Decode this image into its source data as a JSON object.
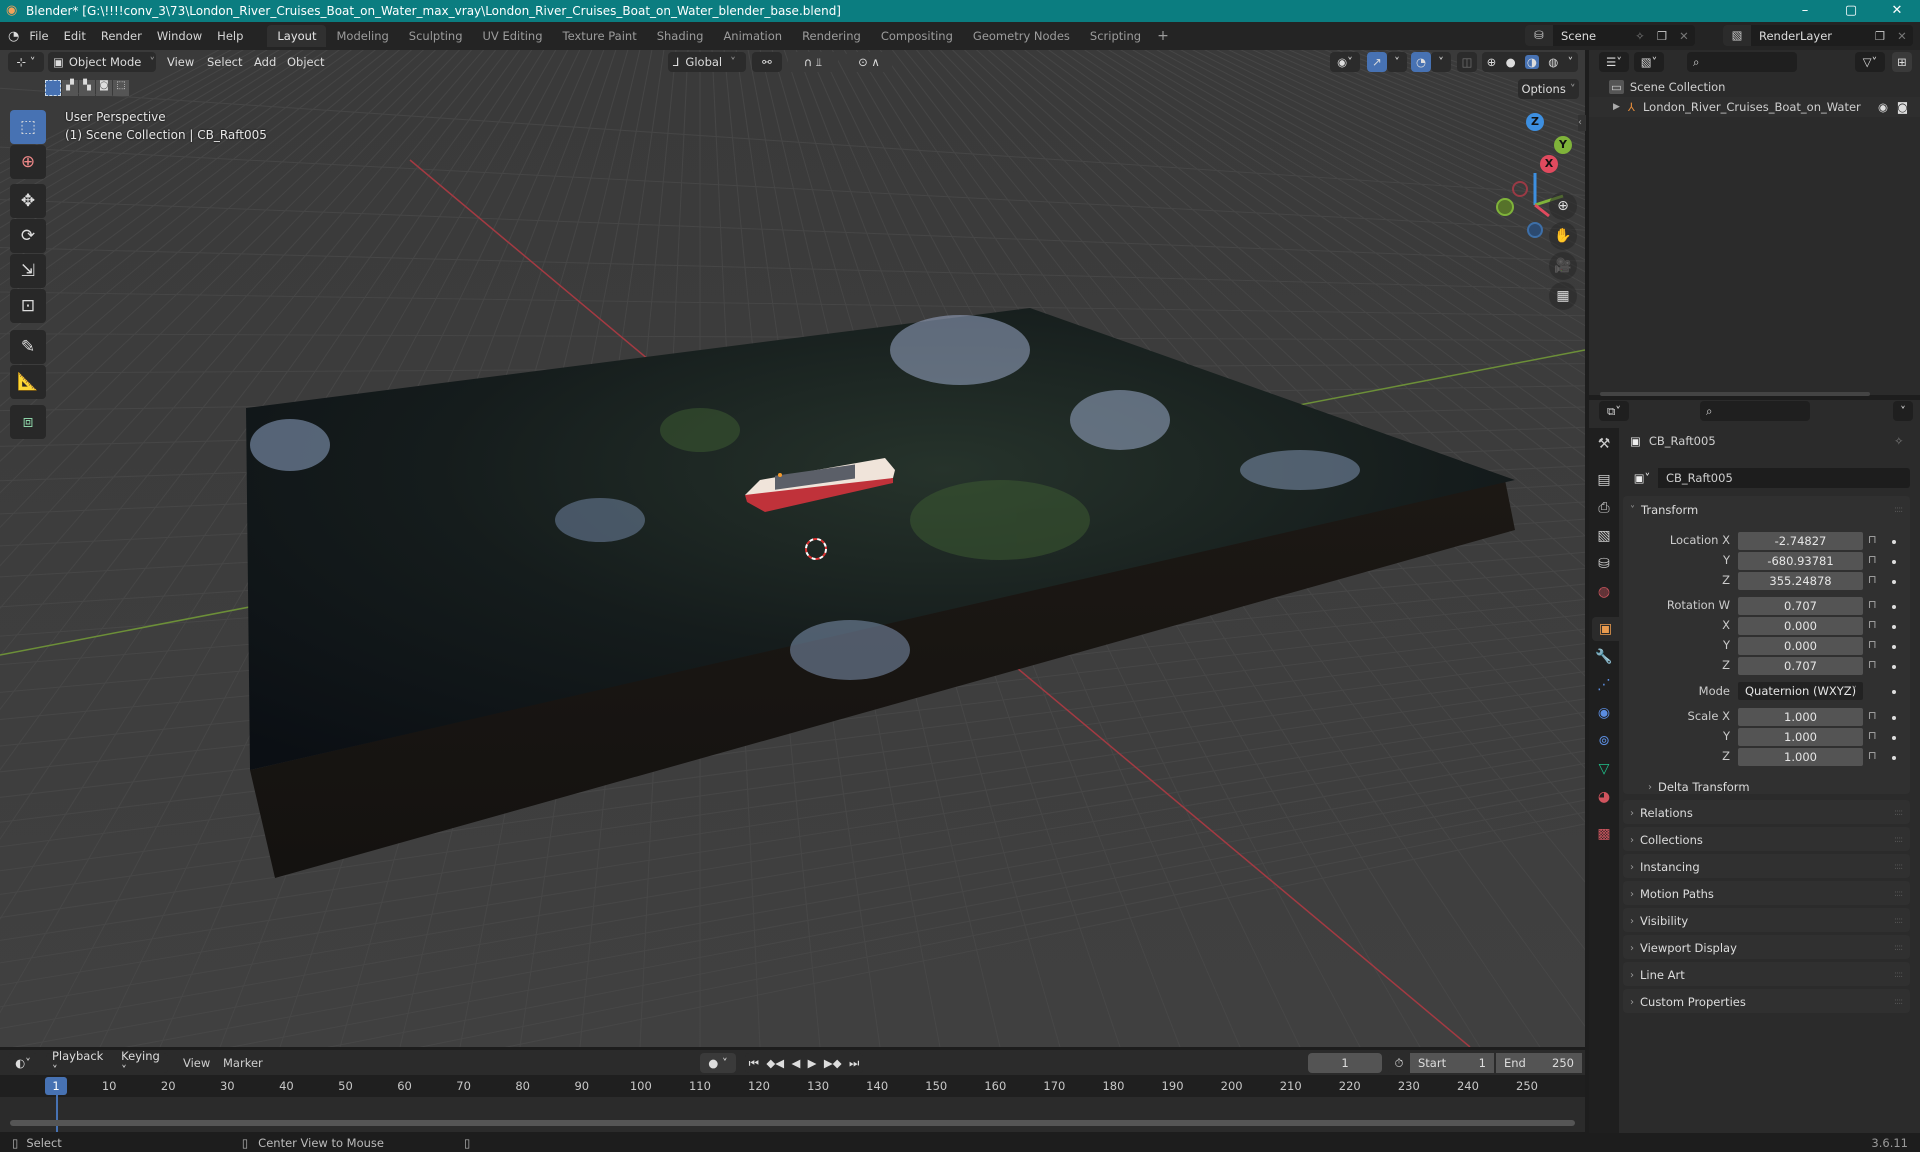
{
  "window": {
    "title": "Blender* [G:\\!!!!conv_3\\73\\London_River_Cruises_Boat_on_Water_max_vray\\London_River_Cruises_Boat_on_Water_blender_base.blend]",
    "controls": {
      "minimize": "–",
      "maximize": "▢",
      "close": "✕"
    }
  },
  "menubar": {
    "menus": [
      "File",
      "Edit",
      "Render",
      "Window",
      "Help"
    ],
    "workspaces": [
      "Layout",
      "Modeling",
      "Sculpting",
      "UV Editing",
      "Texture Paint",
      "Shading",
      "Animation",
      "Rendering",
      "Compositing",
      "Geometry Nodes",
      "Scripting"
    ],
    "active_workspace": "Layout",
    "add_workspace": "+",
    "scene": "Scene",
    "view_layer": "RenderLayer"
  },
  "viewport": {
    "mode": "Object Mode",
    "menus": [
      "View",
      "Select",
      "Add",
      "Object"
    ],
    "orientation": "Global",
    "options_label": "Options",
    "overlay_line1": "User Perspective",
    "overlay_line2": "(1) Scene Collection | CB_Raft005",
    "gizmo_axes": {
      "x": "X",
      "y": "Y",
      "z": "Z"
    },
    "colors": {
      "x_axis": "#e04a5e",
      "y_axis": "#7fb33a",
      "z_axis": "#3d8fe0",
      "accent": "#4772b3"
    },
    "tools": [
      "select-box",
      "cursor",
      "move",
      "rotate",
      "scale",
      "transform",
      "annotate",
      "measure",
      "add-cube"
    ],
    "nav_buttons": [
      "zoom",
      "pan",
      "camera",
      "perspective-toggle"
    ]
  },
  "outliner": {
    "root": "Scene Collection",
    "items": [
      {
        "name": "London_River_Cruises_Boat_on_Water",
        "type": "empty"
      }
    ]
  },
  "properties": {
    "object_name": "CB_Raft005",
    "datablock_name": "CB_Raft005",
    "transform_title": "Transform",
    "location": {
      "label": "Location X",
      "x": "-2.74827",
      "y": "-680.93781",
      "z": "355.24878"
    },
    "rotation": {
      "label": "Rotation W",
      "w": "0.707",
      "x": "0.000",
      "y": "0.000",
      "z": "0.707"
    },
    "mode": {
      "label": "Mode",
      "value": "Quaternion (WXYZ)"
    },
    "scale": {
      "label": "Scale X",
      "x": "1.000",
      "y": "1.000",
      "z": "1.000"
    },
    "axis_labels": {
      "y": "Y",
      "z": "Z",
      "x": "X"
    },
    "delta_transform": "Delta Transform",
    "panels": [
      "Relations",
      "Collections",
      "Instancing",
      "Motion Paths",
      "Visibility",
      "Viewport Display",
      "Line Art",
      "Custom Properties"
    ]
  },
  "timeline": {
    "menus": [
      "Playback",
      "Keying",
      "View",
      "Marker"
    ],
    "current_frame": "1",
    "start_label": "Start",
    "start": "1",
    "end_label": "End",
    "end": "250",
    "ticks": [
      "10",
      "20",
      "30",
      "40",
      "50",
      "60",
      "70",
      "80",
      "90",
      "100",
      "110",
      "120",
      "130",
      "140",
      "150",
      "160",
      "170",
      "180",
      "190",
      "200",
      "210",
      "220",
      "230",
      "240",
      "250"
    ],
    "playhead": "1"
  },
  "statusbar": {
    "left_hint": "Select",
    "middle_hint": "Center View to Mouse",
    "version": "3.6.11"
  }
}
